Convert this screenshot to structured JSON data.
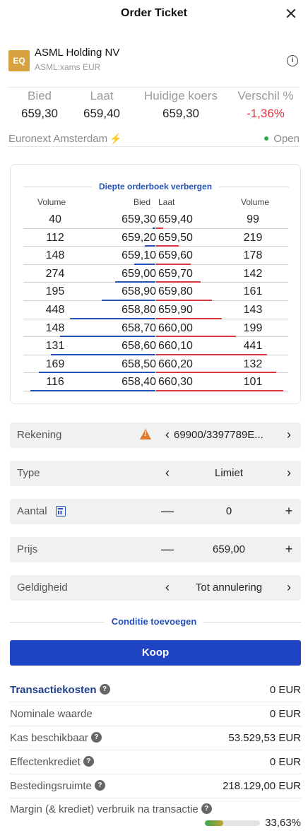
{
  "header": {
    "title": "Order Ticket",
    "close_icon": "close-icon"
  },
  "instrument": {
    "badge": "EQ",
    "name": "ASML Holding NV",
    "subtitle": "ASML:xams EUR",
    "info_icon": "info-icon",
    "badge_color": "#d7a13f"
  },
  "quotes": [
    {
      "label": "Bied",
      "value": "659,30"
    },
    {
      "label": "Laat",
      "value": "659,40"
    },
    {
      "label": "Huidige koers",
      "value": "659,30"
    },
    {
      "label": "Verschil %",
      "value": "-1,36%"
    }
  ],
  "exchange": {
    "name": "Euronext Amsterdam",
    "status": "Open",
    "status_color": "#2eaa4f"
  },
  "orderbook": {
    "toggle_label": "Diepte orderboek verbergen",
    "headers": {
      "volume_bid": "Volume",
      "bid": "Bied",
      "ask": "Laat",
      "volume_ask": "Volume"
    },
    "rows": [
      {
        "vol_bid": "40",
        "bid": "659,30",
        "ask": "659,40",
        "vol_ask": "99"
      },
      {
        "vol_bid": "112",
        "bid": "659,20",
        "ask": "659,50",
        "vol_ask": "219"
      },
      {
        "vol_bid": "148",
        "bid": "659,10",
        "ask": "659,60",
        "vol_ask": "178"
      },
      {
        "vol_bid": "274",
        "bid": "659,00",
        "ask": "659,70",
        "vol_ask": "142"
      },
      {
        "vol_bid": "195",
        "bid": "658,90",
        "ask": "659,80",
        "vol_ask": "161"
      },
      {
        "vol_bid": "448",
        "bid": "658,80",
        "ask": "659,90",
        "vol_ask": "143"
      },
      {
        "vol_bid": "148",
        "bid": "658,70",
        "ask": "660,00",
        "vol_ask": "199"
      },
      {
        "vol_bid": "131",
        "bid": "658,60",
        "ask": "660,10",
        "vol_ask": "441"
      },
      {
        "vol_bid": "169",
        "bid": "658,50",
        "ask": "660,20",
        "vol_ask": "132"
      },
      {
        "vol_bid": "116",
        "bid": "658,40",
        "ask": "660,30",
        "vol_ask": "101"
      }
    ],
    "bid_color": "#2451b8",
    "ask_color": "#d9363e"
  },
  "form": {
    "account": {
      "label": "Rekening",
      "value": "69900/3397789E...",
      "warning_icon": "warning-icon"
    },
    "type": {
      "label": "Type",
      "value": "Limiet"
    },
    "quantity": {
      "label": "Aantal",
      "value": "0",
      "calc_icon": "calculator-icon"
    },
    "price": {
      "label": "Prijs",
      "value": "659,00"
    },
    "validity": {
      "label": "Geldigheid",
      "value": "Tot annulering"
    },
    "add_condition": "Conditie toevoegen",
    "buy_label": "Koop",
    "buy_color": "#1f44c4"
  },
  "controls": {
    "prev": "‹",
    "next": "›",
    "minus": "—",
    "plus": "+"
  },
  "summary": {
    "rows": [
      {
        "label": "Transactiekosten",
        "value": "0 EUR"
      },
      {
        "label": "Nominale waarde",
        "value": "0 EUR"
      },
      {
        "label": "Kas beschikbaar",
        "value": "53.529,53 EUR"
      },
      {
        "label": "Effectenkrediet",
        "value": "0 EUR"
      },
      {
        "label": "Bestedingsruimte",
        "value": "218.129,00 EUR"
      }
    ],
    "margin_label": "Margin (& krediet) verbruik na transactie",
    "margin_value": "33,63%",
    "margin_fraction": 0.3363,
    "help_icon": "question-icon"
  }
}
